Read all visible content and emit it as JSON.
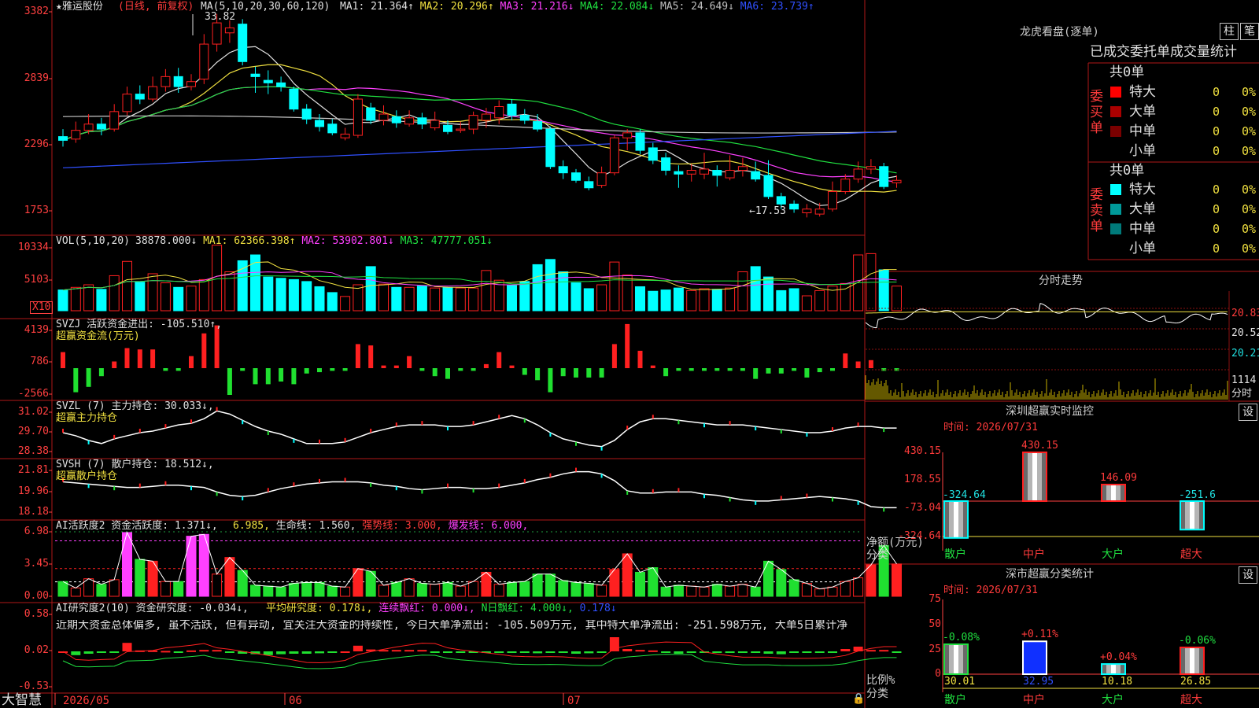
{
  "stock": {
    "name": "★雅运股份",
    "mode": "(日线, 前复权)"
  },
  "kline": {
    "axis": [
      "3382",
      "2839",
      "2296",
      "1753"
    ],
    "ma_title": "MA(5,10,20,30,60,120)",
    "ma": [
      {
        "label": "MA1: 21.364↑",
        "color": "#e0e0e0"
      },
      {
        "label": "MA2: 20.296↑",
        "color": "#f0e040"
      },
      {
        "label": "MA3: 21.216↓",
        "color": "#ff40ff"
      },
      {
        "label": "MA4: 22.084↓",
        "color": "#20e040"
      },
      {
        "label": "MA5: 24.649↓",
        "color": "#c0c0c0"
      },
      {
        "label": "MA6: 23.739↑",
        "color": "#3050ff"
      }
    ],
    "high_mark": "33.82",
    "low_mark": "←17.53",
    "candles": [
      {
        "o": 24.0,
        "c": 23.7,
        "h": 24.6,
        "l": 23.2
      },
      {
        "o": 23.8,
        "c": 24.5,
        "h": 25.2,
        "l": 23.5
      },
      {
        "o": 24.5,
        "c": 25.0,
        "h": 25.8,
        "l": 24.2
      },
      {
        "o": 25.0,
        "c": 24.6,
        "h": 25.5,
        "l": 24.1
      },
      {
        "o": 24.6,
        "c": 26.0,
        "h": 26.6,
        "l": 24.4
      },
      {
        "o": 26.0,
        "c": 27.4,
        "h": 28.0,
        "l": 25.7
      },
      {
        "o": 27.4,
        "c": 27.0,
        "h": 28.1,
        "l": 26.6
      },
      {
        "o": 27.0,
        "c": 28.0,
        "h": 28.8,
        "l": 26.8
      },
      {
        "o": 28.0,
        "c": 28.8,
        "h": 29.4,
        "l": 27.6
      },
      {
        "o": 28.8,
        "c": 28.0,
        "h": 29.5,
        "l": 27.5
      },
      {
        "o": 28.0,
        "c": 28.4,
        "h": 29.0,
        "l": 27.7
      },
      {
        "o": 28.6,
        "c": 31.4,
        "h": 32.2,
        "l": 28.2
      },
      {
        "o": 31.4,
        "c": 33.1,
        "h": 33.82,
        "l": 30.8
      },
      {
        "o": 32.3,
        "c": 32.7,
        "h": 33.3,
        "l": 31.5
      },
      {
        "o": 33.0,
        "c": 30.0,
        "h": 33.4,
        "l": 29.7
      },
      {
        "o": 29.0,
        "c": 28.8,
        "h": 29.6,
        "l": 27.5
      },
      {
        "o": 28.5,
        "c": 28.3,
        "h": 29.3,
        "l": 27.4
      },
      {
        "o": 28.3,
        "c": 28.0,
        "h": 28.8,
        "l": 27.6
      },
      {
        "o": 27.8,
        "c": 26.2,
        "h": 28.0,
        "l": 26.0
      },
      {
        "o": 26.2,
        "c": 25.4,
        "h": 26.6,
        "l": 25.0
      },
      {
        "o": 25.3,
        "c": 24.8,
        "h": 25.8,
        "l": 24.4
      },
      {
        "o": 25.0,
        "c": 24.3,
        "h": 25.4,
        "l": 24.1
      },
      {
        "o": 23.9,
        "c": 24.2,
        "h": 24.7,
        "l": 23.7
      },
      {
        "o": 24.1,
        "c": 27.0,
        "h": 27.4,
        "l": 23.9
      },
      {
        "o": 26.3,
        "c": 25.3,
        "h": 26.7,
        "l": 25.0
      },
      {
        "o": 25.3,
        "c": 25.8,
        "h": 26.5,
        "l": 24.9
      },
      {
        "o": 25.6,
        "c": 25.1,
        "h": 26.1,
        "l": 24.7
      },
      {
        "o": 25.0,
        "c": 25.5,
        "h": 26.1,
        "l": 24.8
      },
      {
        "o": 25.5,
        "c": 25.0,
        "h": 25.9,
        "l": 24.6
      },
      {
        "o": 24.7,
        "c": 25.3,
        "h": 26.0,
        "l": 24.5
      },
      {
        "o": 24.9,
        "c": 24.4,
        "h": 25.3,
        "l": 24.2
      },
      {
        "o": 24.5,
        "c": 24.6,
        "h": 25.2,
        "l": 24.3
      },
      {
        "o": 24.6,
        "c": 25.7,
        "h": 26.0,
        "l": 24.2
      },
      {
        "o": 25.3,
        "c": 25.8,
        "h": 26.3,
        "l": 24.7
      },
      {
        "o": 25.5,
        "c": 26.4,
        "h": 26.9,
        "l": 25.0
      },
      {
        "o": 26.6,
        "c": 25.7,
        "h": 27.0,
        "l": 25.3
      },
      {
        "o": 25.7,
        "c": 25.3,
        "h": 26.2,
        "l": 25.0
      },
      {
        "o": 25.2,
        "c": 24.6,
        "h": 25.8,
        "l": 24.4
      },
      {
        "o": 24.6,
        "c": 21.6,
        "h": 24.8,
        "l": 21.4
      },
      {
        "o": 21.6,
        "c": 21.1,
        "h": 22.1,
        "l": 20.6
      },
      {
        "o": 21.1,
        "c": 20.5,
        "h": 21.4,
        "l": 20.3
      },
      {
        "o": 20.4,
        "c": 19.9,
        "h": 20.8,
        "l": 19.7
      },
      {
        "o": 20.1,
        "c": 21.1,
        "h": 21.6,
        "l": 19.9
      },
      {
        "o": 21.1,
        "c": 23.9,
        "h": 24.1,
        "l": 20.9
      },
      {
        "o": 23.9,
        "c": 24.3,
        "h": 24.6,
        "l": 22.9
      },
      {
        "o": 24.3,
        "c": 22.9,
        "h": 24.6,
        "l": 22.6
      },
      {
        "o": 23.1,
        "c": 22.1,
        "h": 23.5,
        "l": 21.8
      },
      {
        "o": 22.3,
        "c": 21.3,
        "h": 22.7,
        "l": 20.9
      },
      {
        "o": 21.2,
        "c": 21.0,
        "h": 21.7,
        "l": 19.9
      },
      {
        "o": 21.0,
        "c": 21.3,
        "h": 21.8,
        "l": 20.4
      },
      {
        "o": 21.0,
        "c": 21.4,
        "h": 22.7,
        "l": 20.6
      },
      {
        "o": 21.3,
        "c": 20.9,
        "h": 21.7,
        "l": 20.0
      },
      {
        "o": 20.7,
        "c": 21.3,
        "h": 22.5,
        "l": 20.5
      },
      {
        "o": 21.3,
        "c": 21.6,
        "h": 22.3,
        "l": 20.8
      },
      {
        "o": 21.2,
        "c": 20.6,
        "h": 22.0,
        "l": 20.4
      },
      {
        "o": 20.9,
        "c": 19.2,
        "h": 22.1,
        "l": 19.0
      },
      {
        "o": 19.2,
        "c": 18.6,
        "h": 19.5,
        "l": 18.2
      },
      {
        "o": 18.6,
        "c": 18.2,
        "h": 18.9,
        "l": 17.9
      },
      {
        "o": 17.9,
        "c": 18.2,
        "h": 18.6,
        "l": 17.53
      },
      {
        "o": 17.8,
        "c": 18.2,
        "h": 18.7,
        "l": 17.6
      },
      {
        "o": 18.2,
        "c": 19.6,
        "h": 20.4,
        "l": 18.0
      },
      {
        "o": 19.6,
        "c": 20.6,
        "h": 21.0,
        "l": 19.4
      },
      {
        "o": 20.6,
        "c": 21.4,
        "h": 22.0,
        "l": 20.3
      },
      {
        "o": 21.4,
        "c": 21.6,
        "h": 22.2,
        "l": 21.0
      },
      {
        "o": 21.6,
        "c": 20.0,
        "h": 21.9,
        "l": 19.8
      },
      {
        "o": 20.3,
        "c": 20.5,
        "h": 20.9,
        "l": 19.9
      }
    ]
  },
  "vol": {
    "title": "VOL(5,10,20)",
    "items": [
      {
        "label": "38878.000↓",
        "color": "#e0e0e0"
      },
      {
        "label": "MA1: 62366.398↑",
        "color": "#f0e040"
      },
      {
        "label": "MA2: 53902.801↓",
        "color": "#ff40ff"
      },
      {
        "label": "MA3: 47777.051↓",
        "color": "#20e040"
      }
    ],
    "axis": [
      "10334",
      "5103"
    ],
    "unit": "X10",
    "values": [
      3.2,
      3.6,
      4.0,
      3.3,
      5.4,
      7.6,
      4.4,
      5.7,
      4.3,
      3.6,
      3.8,
      4.8,
      10.1,
      6.0,
      7.7,
      8.6,
      5.2,
      5.0,
      4.8,
      4.5,
      3.7,
      2.8,
      2.2,
      4.0,
      6.8,
      4.1,
      3.6,
      3.6,
      3.8,
      3.5,
      3.6,
      3.5,
      3.5,
      6.2,
      4.7,
      3.9,
      4.5,
      7.1,
      7.9,
      6.0,
      4.3,
      3.4,
      4.0,
      7.5,
      5.5,
      3.7,
      3.0,
      3.2,
      3.5,
      3.1,
      3.4,
      3.3,
      3.5,
      6.0,
      6.8,
      5.2,
      3.1,
      3.4,
      2.3,
      3.1,
      3.8,
      4.2,
      8.6,
      8.8,
      6.3,
      3.8
    ]
  },
  "svzj": {
    "title": "SVZJ  活跃资金进出: -105.510↑,",
    "sub": "超赢资金流(万元)",
    "axis": [
      "4139",
      "786",
      "-2566"
    ],
    "values": [
      1.2,
      -1.8,
      -1.4,
      -0.6,
      0.5,
      1.5,
      1.4,
      1.4,
      -0.2,
      -0.2,
      0.9,
      2.6,
      3.2,
      -2.0,
      -0.2,
      -1.2,
      -1.2,
      -1.0,
      -1.2,
      -0.4,
      -0.3,
      -0.2,
      -0.2,
      1.8,
      1.7,
      0.2,
      0.2,
      0.9,
      -0.2,
      -0.6,
      -0.8,
      -0.2,
      -0.2,
      0.3,
      1.2,
      0.2,
      -0.5,
      -0.9,
      -1.8,
      -0.6,
      -0.7,
      -0.7,
      -0.7,
      1.8,
      3.3,
      1.3,
      0.2,
      -0.6,
      -0.2,
      -0.2,
      -0.2,
      -0.2,
      -0.2,
      -0.2,
      -0.8,
      -0.4,
      -0.4,
      -0.2,
      -0.7,
      -0.3,
      -0.2,
      1.1,
      0.5,
      0.6,
      -0.2,
      -0.2
    ]
  },
  "svzl": {
    "title": "SVZL (7) 主力持仓: 30.033↓,",
    "sub": "超赢主力持仓",
    "axis": [
      "31.02",
      "29.70",
      "28.38"
    ],
    "values": [
      29.7,
      29.5,
      29.2,
      29.0,
      29.3,
      29.5,
      29.7,
      29.8,
      30.0,
      30.2,
      30.3,
      30.6,
      31.1,
      30.9,
      30.5,
      30.1,
      29.8,
      29.6,
      29.3,
      29.0,
      29.0,
      29.0,
      29.1,
      29.4,
      29.7,
      29.9,
      30.1,
      30.2,
      30.2,
      30.2,
      30.1,
      30.1,
      30.2,
      30.4,
      30.6,
      30.8,
      30.6,
      30.2,
      29.7,
      29.3,
      29.1,
      28.9,
      28.8,
      29.2,
      29.9,
      30.4,
      30.6,
      30.6,
      30.5,
      30.4,
      30.3,
      30.2,
      30.2,
      30.2,
      30.1,
      30.0,
      29.9,
      29.8,
      29.7,
      29.7,
      29.8,
      30.0,
      30.1,
      30.1,
      30.0,
      30.0
    ]
  },
  "svsh": {
    "title": "SVSH (7) 散户持仓: 18.512↓,",
    "sub": "超赢散户持仓",
    "axis": [
      "21.81",
      "19.96",
      "18.18"
    ],
    "values": [
      20.8,
      20.7,
      20.6,
      20.5,
      20.4,
      20.3,
      20.3,
      20.4,
      20.5,
      20.5,
      20.4,
      20.3,
      19.9,
      19.6,
      19.5,
      19.6,
      19.9,
      20.2,
      20.4,
      20.6,
      20.7,
      20.8,
      20.8,
      20.8,
      20.7,
      20.5,
      20.4,
      20.2,
      20.1,
      20.2,
      20.3,
      20.3,
      20.2,
      20.2,
      20.3,
      20.5,
      20.7,
      21.0,
      21.2,
      21.5,
      21.7,
      21.7,
      21.5,
      20.9,
      20.0,
      19.8,
      19.8,
      19.9,
      19.9,
      19.9,
      19.7,
      19.6,
      19.4,
      19.2,
      19.1,
      19.1,
      19.2,
      19.3,
      19.4,
      19.5,
      19.4,
      19.3,
      19.1,
      18.6,
      18.5,
      18.5
    ]
  },
  "ai_act": {
    "title": "AI活跃度2 资金活跃度: 1.371↓,",
    "items": [
      {
        "label": "6.985,",
        "color": "#f0e040"
      },
      {
        "label": "生命线: 1.560,",
        "color": "#e0e0e0"
      },
      {
        "label": "强势线: 3.000,",
        "color": "#ff3b3b"
      },
      {
        "label": "爆发线: 6.000,",
        "color": "#ff40ff"
      }
    ],
    "axis": [
      "6.98",
      "3.45",
      "0.00"
    ],
    "values": [
      1.6,
      0.9,
      1.9,
      1.3,
      1.8,
      6.9,
      4.0,
      3.8,
      1.6,
      1.6,
      6.5,
      6.7,
      2.4,
      4.2,
      2.8,
      1.2,
      1.1,
      1.0,
      1.4,
      1.5,
      1.5,
      1.1,
      1.0,
      3.0,
      2.7,
      1.2,
      1.5,
      1.9,
      1.4,
      1.3,
      1.5,
      1.1,
      1.6,
      2.6,
      1.3,
      1.5,
      1.6,
      2.4,
      2.4,
      1.7,
      1.5,
      1.4,
      1.2,
      2.9,
      4.6,
      2.6,
      3.1,
      1.0,
      1.2,
      1.1,
      1.0,
      1.3,
      1.1,
      1.3,
      1.0,
      3.8,
      2.9,
      1.8,
      1.4,
      0.8,
      1.0,
      1.6,
      2.0,
      3.4,
      5.5,
      3.5,
      1.4
    ]
  },
  "ai_res": {
    "title": "AI研究度2(10) 资金研究度: -0.034↓,",
    "items": [
      {
        "label": "平均研究度: 0.178↓,",
        "color": "#f0e040"
      },
      {
        "label": "连续飘红: 0.000↓,",
        "color": "#ff40ff"
      },
      {
        "label": "N日飘红: 4.000↓,",
        "color": "#20e040"
      },
      {
        "label": "0.178↓",
        "color": "#3050ff"
      }
    ],
    "comment": "近期大资金总体偏多, 虽不活跃, 但有异动, 宜关注大资金的持续性, 今日大单净流出: -105.509万元, 其中特大单净流出: -251.598万元, 大单5日累计净",
    "axis": [
      "0.58",
      "0.02",
      "-0.53"
    ],
    "values": [
      0,
      -0.08,
      -0.05,
      -0.03,
      -0.03,
      0.18,
      0.02,
      0.02,
      0.01,
      -0.01,
      0.02,
      0.03,
      0.03,
      -0.03,
      -0.05,
      -0.06,
      -0.08,
      -0.06,
      -0.05,
      -0.05,
      -0.04,
      -0.03,
      0,
      0.12,
      0.04,
      0.03,
      0.03,
      0.03,
      0.03,
      -0.01,
      -0.03,
      -0.03,
      -0.02,
      -0.02,
      -0.02,
      -0.03,
      -0.03,
      -0.04,
      -0.02,
      -0.03,
      -0.05,
      -0.04,
      -0.02,
      0.3,
      0.05,
      0.03,
      0.02,
      -0.02,
      -0.05,
      -0.03,
      -0.02,
      -0.02,
      -0.03,
      -0.03,
      -0.02,
      -0.05,
      -0.06,
      -0.03,
      -0.02,
      -0.02,
      -0.01,
      0.05,
      0.1,
      0.03,
      0.03,
      -0.02
    ]
  },
  "dates": [
    "2026/05",
    "06",
    "07"
  ],
  "brand": "大智慧",
  "right": {
    "lhb_title": "龙虎看盘(逐单)",
    "btn_zhu": "柱",
    "btn_bi": "笔",
    "stat_title": "已成交委托单成交量统计",
    "buy_label": "委买单",
    "sell_label": "委卖单",
    "buy_total": "共0单",
    "sell_total": "共0单",
    "buy_rows": [
      {
        "name": "特大",
        "count": "0",
        "pct": "0%",
        "color": "#ff0000"
      },
      {
        "name": "大单",
        "count": "0",
        "pct": "0%",
        "color": "#aa0000"
      },
      {
        "name": "中单",
        "count": "0",
        "pct": "0%",
        "color": "#7a0000"
      },
      {
        "name": "小单",
        "count": "0",
        "pct": "0%",
        "color": ""
      }
    ],
    "sell_rows": [
      {
        "name": "特大",
        "count": "0",
        "pct": "0%",
        "color": "#00ffff"
      },
      {
        "name": "大单",
        "count": "0",
        "pct": "0%",
        "color": "#009a9a"
      },
      {
        "name": "中单",
        "count": "0",
        "pct": "0%",
        "color": "#007a7a"
      },
      {
        "name": "小单",
        "count": "0",
        "pct": "0%",
        "color": ""
      }
    ],
    "fenshi_title": "分时走势",
    "fenshi_axis": [
      "20.83",
      "20.52",
      "20.21",
      "1114",
      "分时"
    ],
    "sz_title": "深圳超赢实时监控",
    "sz_btn": "设",
    "sz_time": "时间: 2026/07/31",
    "sz_axis": [
      "430.15",
      "178.55",
      "-73.04",
      "-324.64"
    ],
    "sz_unit": "净额(万元)",
    "sz_cat": "分类",
    "sz_bars": [
      {
        "label": "散户",
        "value": -324.64,
        "text": "-324.64"
      },
      {
        "label": "中户",
        "value": 430.15,
        "text": "430.15"
      },
      {
        "label": "大户",
        "value": 146.09,
        "text": "146.09"
      },
      {
        "label": "超大",
        "value": -251.6,
        "text": "-251.6"
      }
    ],
    "sc_title": "深市超赢分类统计",
    "sc_btn": "设",
    "sc_time": "时间: 2026/07/31",
    "sc_axis": [
      "75",
      "50",
      "25",
      "0"
    ],
    "sc_unit": "比例%",
    "sc_cat": "分类",
    "sc_bars": [
      {
        "label": "散户",
        "value": 30.01,
        "delta": "-0.08%",
        "text": "30.01"
      },
      {
        "label": "中户",
        "value": 32.95,
        "delta": "+0.11%",
        "text": "32.95"
      },
      {
        "label": "大户",
        "value": 10.18,
        "delta": "+0.04%",
        "text": "10.18"
      },
      {
        "label": "超大",
        "value": 26.85,
        "delta": "-0.06%",
        "text": "26.85"
      }
    ]
  }
}
